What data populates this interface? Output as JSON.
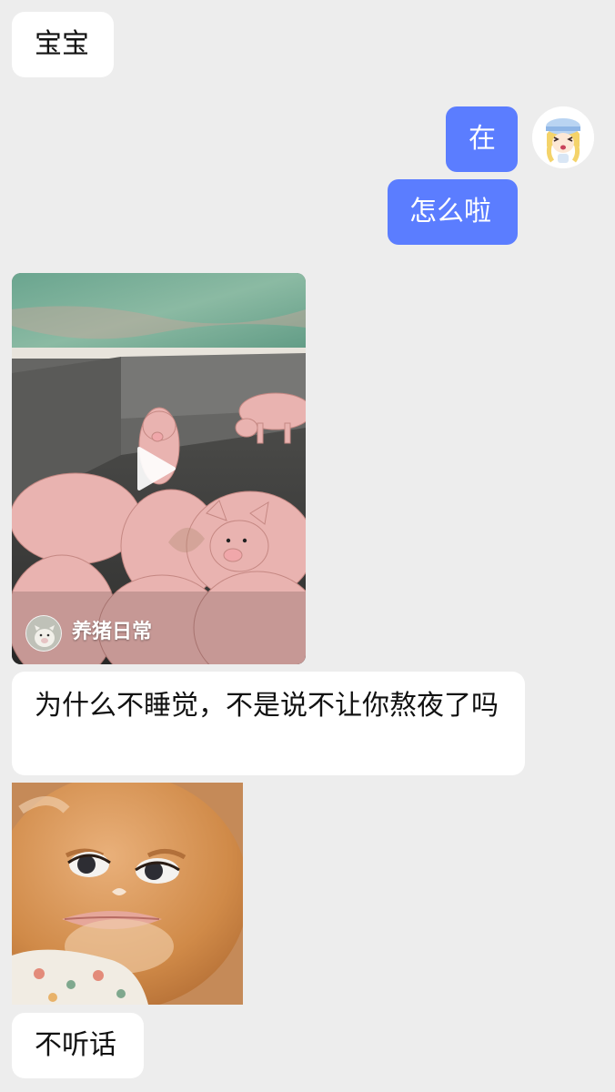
{
  "messages": {
    "m1_text": "宝宝",
    "m2_text": "在",
    "m3_text": "怎么啦",
    "m5_text": "为什么不睡觉，不是说不让你熬夜了吗",
    "m7_text": "不听话"
  },
  "video_card": {
    "channel_name": "养猪日常",
    "play_icon": "play-icon"
  },
  "colors": {
    "background": "#ededed",
    "incoming_bubble": "#ffffff",
    "outgoing_bubble": "#5b7dff",
    "outgoing_text": "#ffffff"
  }
}
